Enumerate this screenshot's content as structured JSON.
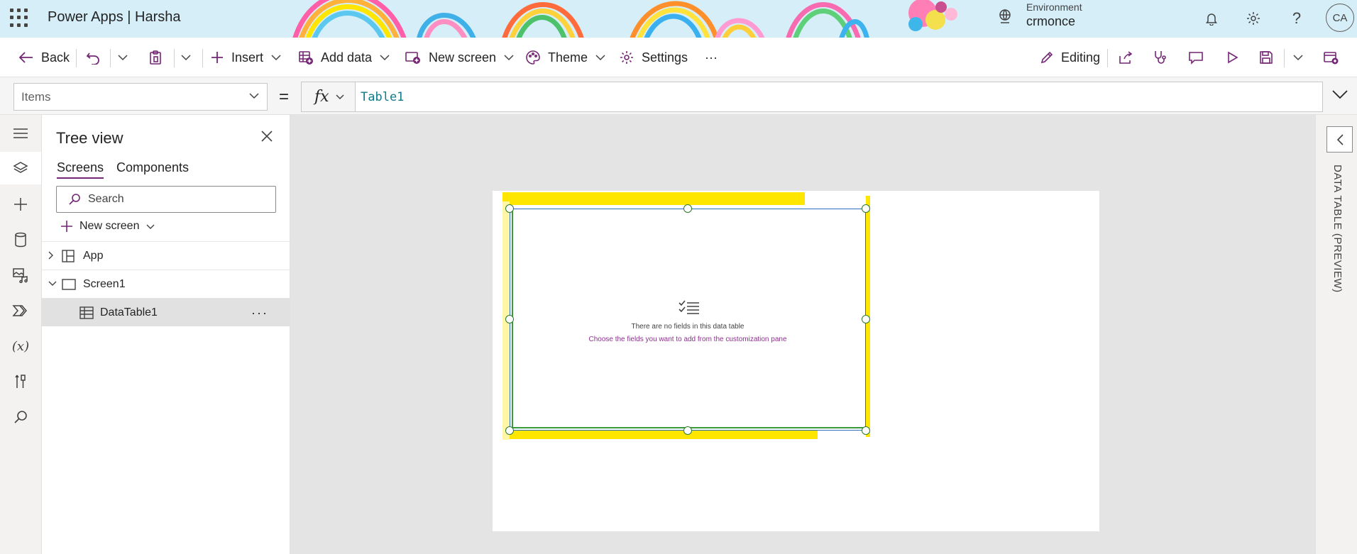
{
  "header": {
    "app_title": "Power Apps | Harsha",
    "environment_label": "Environment",
    "environment_value": "crmonce",
    "avatar_initials": "CA",
    "icons": [
      "waffle-icon",
      "environment-icon",
      "bell-icon",
      "gear-icon",
      "help-icon"
    ]
  },
  "toolbar": {
    "back_label": "Back",
    "insert_label": "Insert",
    "add_data_label": "Add data",
    "new_screen_label": "New screen",
    "theme_label": "Theme",
    "settings_label": "Settings",
    "more_label": "···",
    "editing_label": "Editing"
  },
  "formula_bar": {
    "property": "Items",
    "equals": "=",
    "fx": "fx",
    "formula": "Table1"
  },
  "tree_view": {
    "title": "Tree view",
    "tabs": [
      {
        "label": "Screens",
        "active": true
      },
      {
        "label": "Components",
        "active": false
      }
    ],
    "search_placeholder": "Search",
    "new_screen_label": "New screen",
    "items": [
      {
        "label": "App",
        "icon": "app-icon",
        "expanded": false
      },
      {
        "label": "Screen1",
        "icon": "screen-icon",
        "expanded": true
      },
      {
        "label": "DataTable1",
        "icon": "table-icon",
        "selected": true,
        "more": "···"
      }
    ]
  },
  "canvas": {
    "empty_title": "There are no fields in this data table",
    "empty_subtitle": "Choose the fields you want to add from the customization pane"
  },
  "right_panel": {
    "label": "DATA TABLE (PREVIEW)"
  },
  "colors": {
    "header_bg": "#d6eef8",
    "accent_purple": "#742774",
    "highlight_yellow": "#ffe600",
    "selection_blue": "#2d6dbf",
    "formula_teal": "#0f7b8a"
  }
}
